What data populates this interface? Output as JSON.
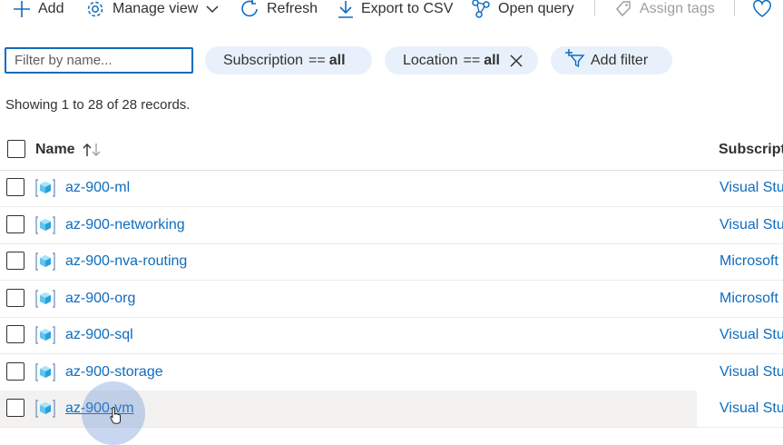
{
  "toolbar": {
    "add": "Add",
    "manage_view": "Manage view",
    "refresh": "Refresh",
    "export": "Export to CSV",
    "open_query": "Open query",
    "assign_tags": "Assign tags"
  },
  "filters": {
    "search_placeholder": "Filter by name...",
    "subscription": {
      "field": "Subscription",
      "op": "==",
      "value": "all"
    },
    "location": {
      "field": "Location",
      "op": "==",
      "value": "all"
    },
    "add_filter": "Add filter"
  },
  "records_text": "Showing 1 to 28 of 28 records.",
  "table": {
    "col_name": "Name",
    "col_subscription": "Subscript",
    "rows": [
      {
        "name": "az-900-ml",
        "subscription": "Visual Stu"
      },
      {
        "name": "az-900-networking",
        "subscription": "Visual Stu"
      },
      {
        "name": "az-900-nva-routing",
        "subscription": "Microsoft"
      },
      {
        "name": "az-900-org",
        "subscription": "Microsoft"
      },
      {
        "name": "az-900-sql",
        "subscription": "Visual Stu"
      },
      {
        "name": "az-900-storage",
        "subscription": "Visual Stu"
      },
      {
        "name": "az-900-vm",
        "subscription": "Visual Stu"
      }
    ]
  },
  "colors": {
    "accent": "#0f6cbd",
    "pill": "#e8f1fb",
    "text": "#323130"
  },
  "icons": [
    "add-icon",
    "gear-icon",
    "chevron-down-icon",
    "refresh-icon",
    "download-icon",
    "query-icon",
    "tag-icon",
    "heart-icon",
    "close-icon",
    "add-filter-icon",
    "sort-icon",
    "resource-group-icon"
  ]
}
